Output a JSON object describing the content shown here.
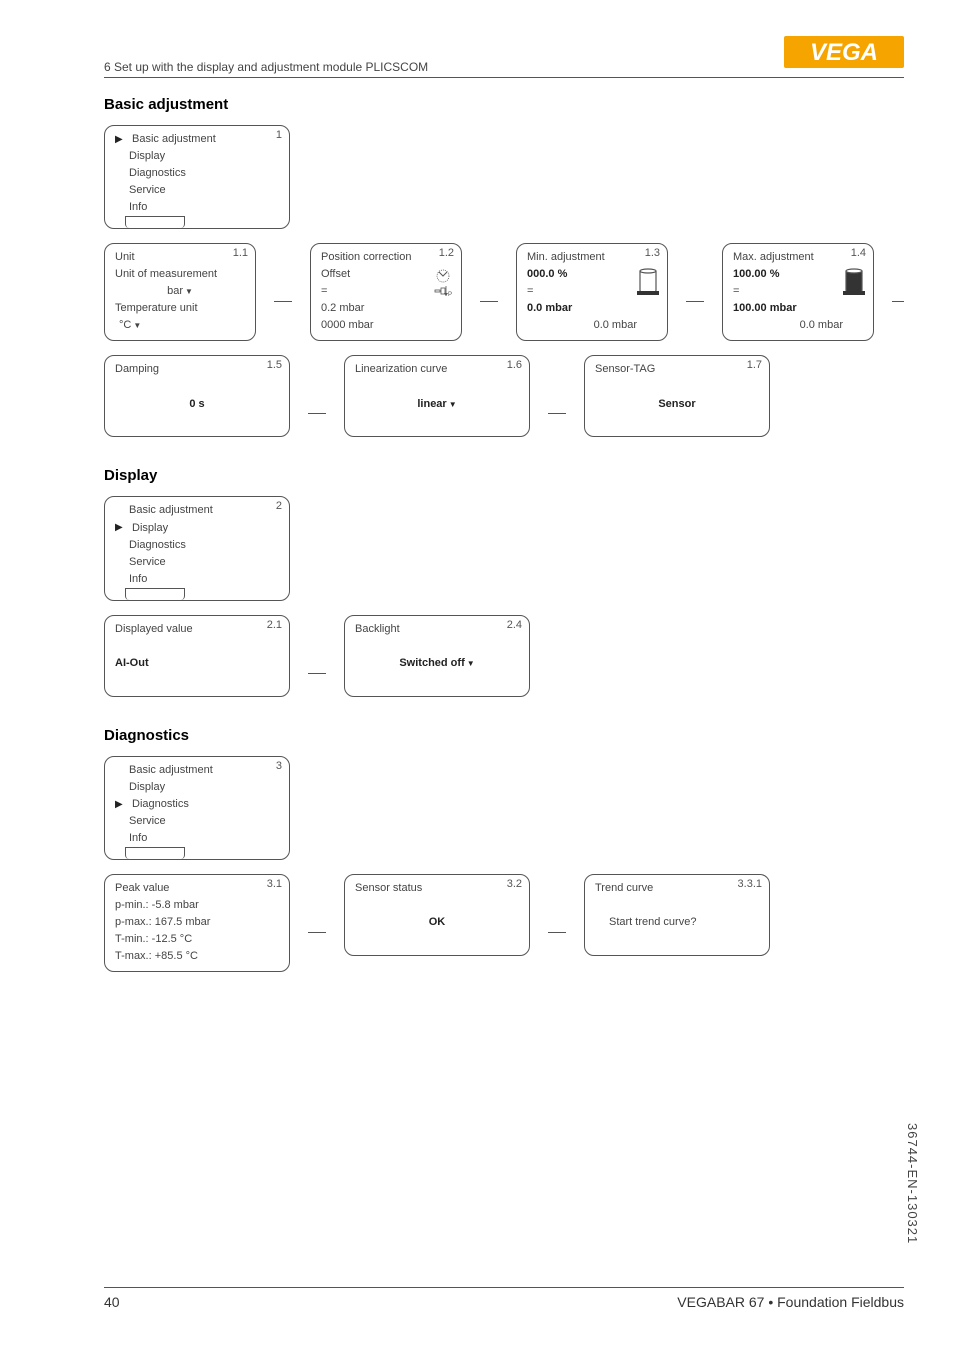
{
  "header": {
    "text": "6 Set up with the display and adjustment module PLICSCOM"
  },
  "logo": {
    "text": "VEGA"
  },
  "sections": {
    "basic_adjustment": {
      "title": "Basic adjustment",
      "menu": {
        "num": "1",
        "items": [
          "Basic adjustment",
          "Display",
          "Diagnostics",
          "Service",
          "Info"
        ],
        "selected": 0
      },
      "screens": [
        {
          "num": "1.1",
          "lines": [
            {
              "t": "Unit"
            },
            {
              "t": "Unit of measurement"
            },
            {
              "t": "bar",
              "center_dropdown": true
            },
            {
              "t": "Temperature unit"
            },
            {
              "t": "°C",
              "indent_dropdown": true
            }
          ]
        },
        {
          "num": "1.2",
          "icon": "pos",
          "lines": [
            {
              "t": "Position correction"
            },
            {
              "t": "Offset"
            },
            {
              "t": "="
            },
            {
              "t": "0.2 mbar"
            },
            {
              "t": "0000 mbar"
            }
          ]
        },
        {
          "num": "1.3",
          "icon": "min",
          "lines": [
            {
              "t": "Min. adjustment"
            },
            {
              "t": "000.0 %",
              "bold": true
            },
            {
              "t": "="
            },
            {
              "t": "0.0 mbar",
              "bold": true
            },
            {
              "t": "0.0 mbar",
              "right": true
            }
          ]
        },
        {
          "num": "1.4",
          "icon": "max",
          "lines": [
            {
              "t": "Max. adjustment"
            },
            {
              "t": "100.00 %",
              "bold": true
            },
            {
              "t": "="
            },
            {
              "t": "100.00 mbar",
              "bold": true
            },
            {
              "t": "0.0 mbar",
              "right": true
            }
          ]
        },
        {
          "num": "1.5",
          "lines": [
            {
              "t": "Damping"
            },
            {
              "t": "",
              "spacer": true
            },
            {
              "t": "0 s",
              "center_bold": true
            }
          ]
        },
        {
          "num": "1.6",
          "lines": [
            {
              "t": "Linearization curve"
            },
            {
              "t": "",
              "spacer": true
            },
            {
              "t": "linear",
              "center_bold_dropdown": true
            }
          ]
        },
        {
          "num": "1.7",
          "lines": [
            {
              "t": "Sensor-TAG"
            },
            {
              "t": "",
              "spacer": true
            },
            {
              "t": "Sensor",
              "center_bold": true
            }
          ]
        }
      ]
    },
    "display": {
      "title": "Display",
      "menu": {
        "num": "2",
        "items": [
          "Basic adjustment",
          "Display",
          "Diagnostics",
          "Service",
          "Info"
        ],
        "selected": 1
      },
      "screens": [
        {
          "num": "2.1",
          "lines": [
            {
              "t": "Displayed value"
            },
            {
              "t": "",
              "spacer": true
            },
            {
              "t": "AI-Out",
              "bold_left": true
            }
          ]
        },
        {
          "num": "2.4",
          "lines": [
            {
              "t": "Backlight"
            },
            {
              "t": "",
              "spacer": true
            },
            {
              "t": "Switched off",
              "center_bold_dropdown": true
            }
          ]
        }
      ]
    },
    "diagnostics": {
      "title": "Diagnostics",
      "menu": {
        "num": "3",
        "items": [
          "Basic adjustment",
          "Display",
          "Diagnostics",
          "Service",
          "Info"
        ],
        "selected": 2
      },
      "screens": [
        {
          "num": "3.1",
          "lines": [
            {
              "t": "Peak value"
            },
            {
              "t": "p-min.: -5.8 mbar"
            },
            {
              "t": "p-max.: 167.5 mbar"
            },
            {
              "t": "T-min.: -12.5 °C"
            },
            {
              "t": "T-max.: +85.5 °C"
            }
          ]
        },
        {
          "num": "3.2",
          "lines": [
            {
              "t": "Sensor status"
            },
            {
              "t": "",
              "spacer": true
            },
            {
              "t": "OK",
              "center_bold": true
            }
          ]
        },
        {
          "num": "3.3.1",
          "lines": [
            {
              "t": "Trend curve"
            },
            {
              "t": "",
              "spacer": true
            },
            {
              "t": "Start trend curve?",
              "indent": true
            }
          ]
        }
      ]
    }
  },
  "footer": {
    "page": "40",
    "product": "VEGABAR 67 • Foundation Fieldbus"
  },
  "side_code": "36744-EN-130321"
}
